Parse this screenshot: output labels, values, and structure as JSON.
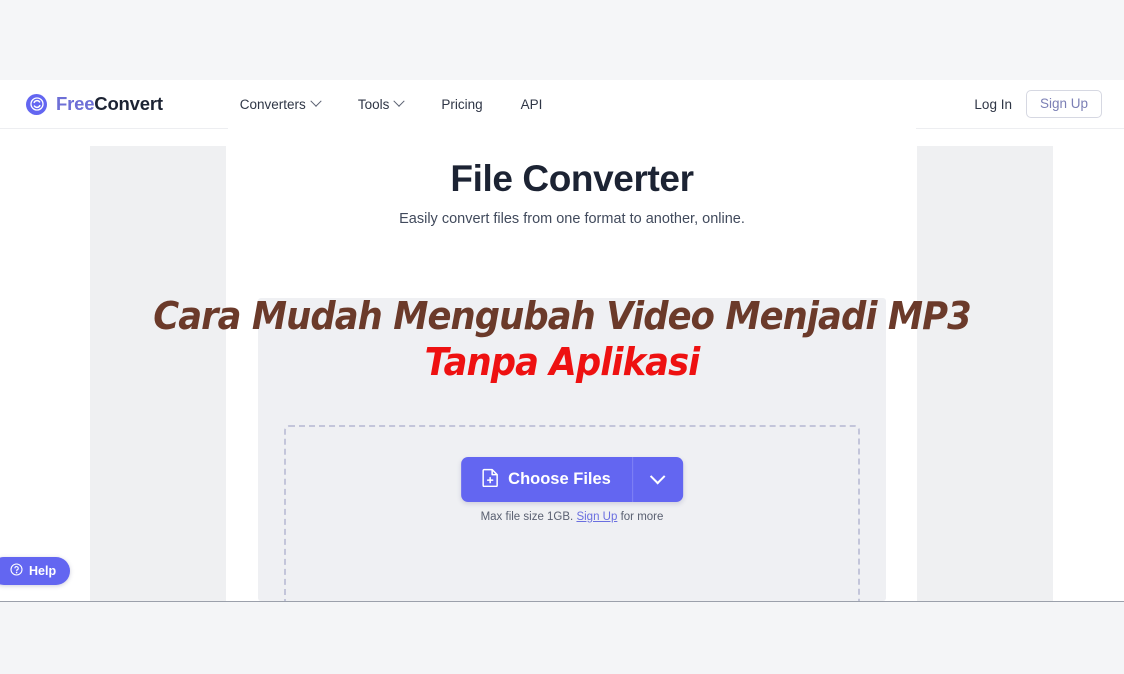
{
  "navbar": {
    "brand": {
      "icon": "refresh-circle-icon",
      "text_primary": "Free",
      "text_secondary": "Convert"
    },
    "links": [
      {
        "label": "Converters",
        "has_dropdown": true,
        "icon": "chevron-down-icon"
      },
      {
        "label": "Tools",
        "has_dropdown": true,
        "icon": "chevron-down-icon"
      },
      {
        "label": "Pricing",
        "has_dropdown": false
      },
      {
        "label": "API",
        "has_dropdown": false
      }
    ],
    "login_label": "Log In",
    "signup_label": "Sign Up"
  },
  "hero": {
    "title": "File Converter",
    "subtitle": "Easily convert files from one format to another, online."
  },
  "converter": {
    "choose_files_label": "Choose Files",
    "choose_files_icon": "file-plus-icon",
    "dropdown_icon": "chevron-down-icon",
    "note_prefix": "Max file size 1GB.",
    "note_link": "Sign Up",
    "note_suffix": "for more"
  },
  "help_widget": {
    "label": "Help",
    "icon": "question-circle-icon"
  },
  "overlay": {
    "line_1": "Cara Mudah Mengubah Video Menjadi MP3",
    "line_2": "Tanpa Aplikasi"
  },
  "colors": {
    "brand_purple": "#6366f1",
    "heading_navy": "#1c2333",
    "overlay_brown": "#6b3a2a",
    "overlay_red": "#ee1111",
    "page_background": "#f4f5f7",
    "ad_placeholder": "#eff0f2"
  }
}
